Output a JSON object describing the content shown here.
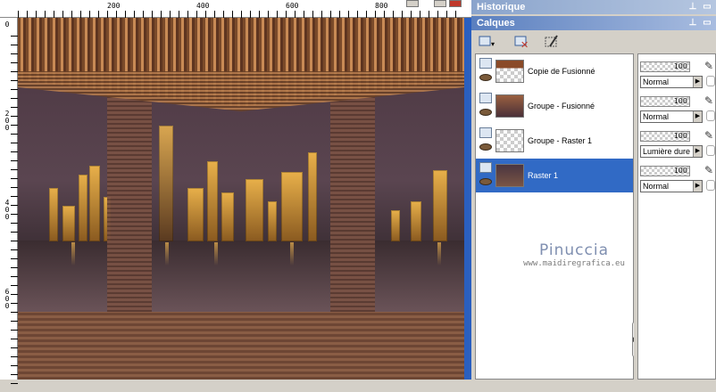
{
  "ruler": {
    "top_labels": [
      "200",
      "400",
      "600",
      "800"
    ],
    "left_labels": [
      [
        "0"
      ],
      [
        "2",
        "0",
        "0"
      ],
      [
        "4",
        "0",
        "0"
      ],
      [
        "6",
        "0",
        "0"
      ]
    ]
  },
  "panels": {
    "history_title": "Historique",
    "layers_title": "Calques",
    "pin_icon": "pin-icon",
    "dock_icon": "dock-icon"
  },
  "layers": [
    {
      "name": "Copie de Fusionné",
      "opacity": "100",
      "blend": "Normal"
    },
    {
      "name": "Groupe - Fusionné",
      "opacity": "100",
      "blend": "Normal"
    },
    {
      "name": "Groupe - Raster 1",
      "opacity": "100",
      "blend": "Lumière dure"
    },
    {
      "name": "Raster 1",
      "opacity": "100",
      "blend": "Normal",
      "selected": true
    }
  ],
  "watermark": {
    "name": "Pinuccia",
    "url": "www.maidiregrafica.eu"
  },
  "colors": {
    "selection": "#316ac5",
    "panel_bg": "#d4d0c8",
    "title_blue": "#5a7fbf"
  }
}
